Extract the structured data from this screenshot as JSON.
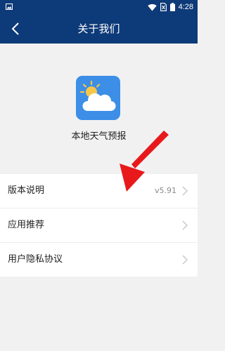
{
  "status_bar": {
    "time": "4:28"
  },
  "header": {
    "title": "关于我们",
    "back_icon": "chevron-left-icon"
  },
  "app": {
    "name": "本地天气预报",
    "icon": "weather-sun-cloud-icon"
  },
  "menu": {
    "items": [
      {
        "label": "版本说明",
        "value": "v5.91"
      },
      {
        "label": "应用推荐",
        "value": ""
      },
      {
        "label": "用户隐私协议",
        "value": ""
      }
    ]
  },
  "colors": {
    "header": "#0d3a78",
    "background": "#f1f1f1",
    "icon_bg": "#3c8ee6",
    "annotation_arrow": "#e8191b"
  }
}
